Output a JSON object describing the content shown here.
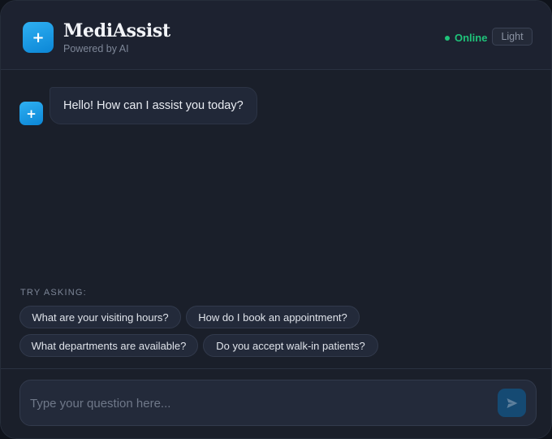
{
  "header": {
    "logo_glyph": "+",
    "title": "MediAssist",
    "subtitle": "Powered by AI",
    "status": "Online",
    "theme_toggle": "Light"
  },
  "messages": [
    {
      "sender": "assistant",
      "avatar_glyph": "+",
      "text": "Hello! How can I assist you today?"
    }
  ],
  "suggestions": {
    "label": "TRY ASKING:",
    "items": [
      "What are your visiting hours?",
      "How do I book an appointment?",
      "What departments are available?",
      "Do you accept walk-in patients?"
    ]
  },
  "composer": {
    "value": "",
    "placeholder": "Type your question here...",
    "send_icon": "send-icon"
  },
  "colors": {
    "accent": "#1a9be6",
    "online": "#1fc37a",
    "background": "#1a1f2a"
  }
}
